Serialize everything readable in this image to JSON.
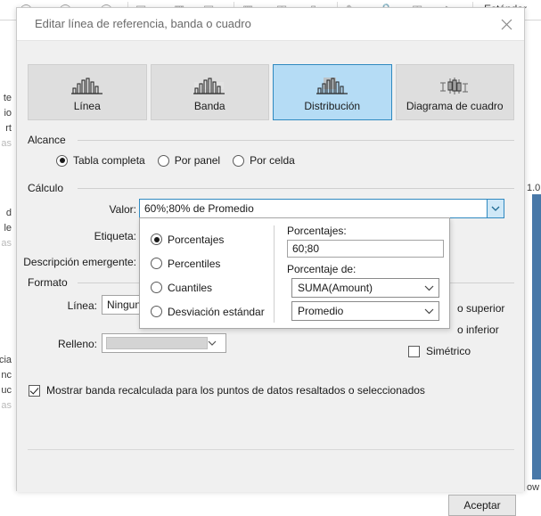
{
  "background": {
    "toolbar_icons": [
      "ellipse-icon",
      "ellipse-icon",
      "circle-icon",
      "square-dot-icon",
      "bar-chart-icon",
      "square-dot-icon",
      "grid-icon",
      "layout-icon",
      "rectangle-icon",
      "pen-icon",
      "lock-icon",
      "box-icon",
      "play-icon"
    ],
    "standard_label": "Estándar",
    "left_fragments": [
      "te",
      "io",
      "rt",
      "as",
      "d",
      "le",
      "as",
      "cia",
      "nc",
      "uc",
      "as"
    ],
    "right_value_fragment": "1.0",
    "bottom_fragment": "ow",
    "accent_color": "#4878a8"
  },
  "dialog": {
    "title": "Editar línea de referencia, banda o cuadro",
    "close_icon": "close-icon",
    "types": [
      {
        "label": "Línea",
        "icon": "line-chart-icon",
        "selected": false
      },
      {
        "label": "Banda",
        "icon": "band-chart-icon",
        "selected": false
      },
      {
        "label": "Distribución",
        "icon": "distribution-chart-icon",
        "selected": true
      },
      {
        "label": "Diagrama de cuadro",
        "icon": "box-plot-icon",
        "selected": false
      }
    ],
    "scope": {
      "group_label": "Alcance",
      "options": [
        {
          "label": "Tabla completa",
          "selected": true
        },
        {
          "label": "Por panel",
          "selected": false
        },
        {
          "label": "Por celda",
          "selected": false
        }
      ]
    },
    "calculation": {
      "group_label": "Cálculo",
      "value_label": "Valor:",
      "value": "60%;80% de Promedio",
      "label_label": "Etiqueta:",
      "tooltip_label": "Descripción emergente:"
    },
    "format": {
      "group_label": "Formato",
      "line_label": "Línea:",
      "line_value": "Ninguno",
      "fill_label": "Relleno:",
      "fill_value": "",
      "fill_swatch_color": "#d4d4d4",
      "upper_fill_label": "o superior",
      "lower_fill_label": "o inferior",
      "symmetric_label": "Simétrico",
      "symmetric_checked": false
    },
    "recalculated_band": {
      "label": "Mostrar banda recalculada para los puntos de datos resaltados o seleccionados",
      "checked": true
    },
    "ok_label": "Aceptar"
  },
  "popup": {
    "modes": [
      {
        "label": "Porcentajes",
        "selected": true
      },
      {
        "label": "Percentiles",
        "selected": false
      },
      {
        "label": "Cuantiles",
        "selected": false
      },
      {
        "label": "Desviación estándar",
        "selected": false
      }
    ],
    "percentages_label": "Porcentajes:",
    "percentages_value": "60;80",
    "percentage_of_label": "Porcentaje de:",
    "field_value": "SUMA(Amount)",
    "aggregation_value": "Promedio",
    "chevron_icon": "chevron-down-icon"
  }
}
